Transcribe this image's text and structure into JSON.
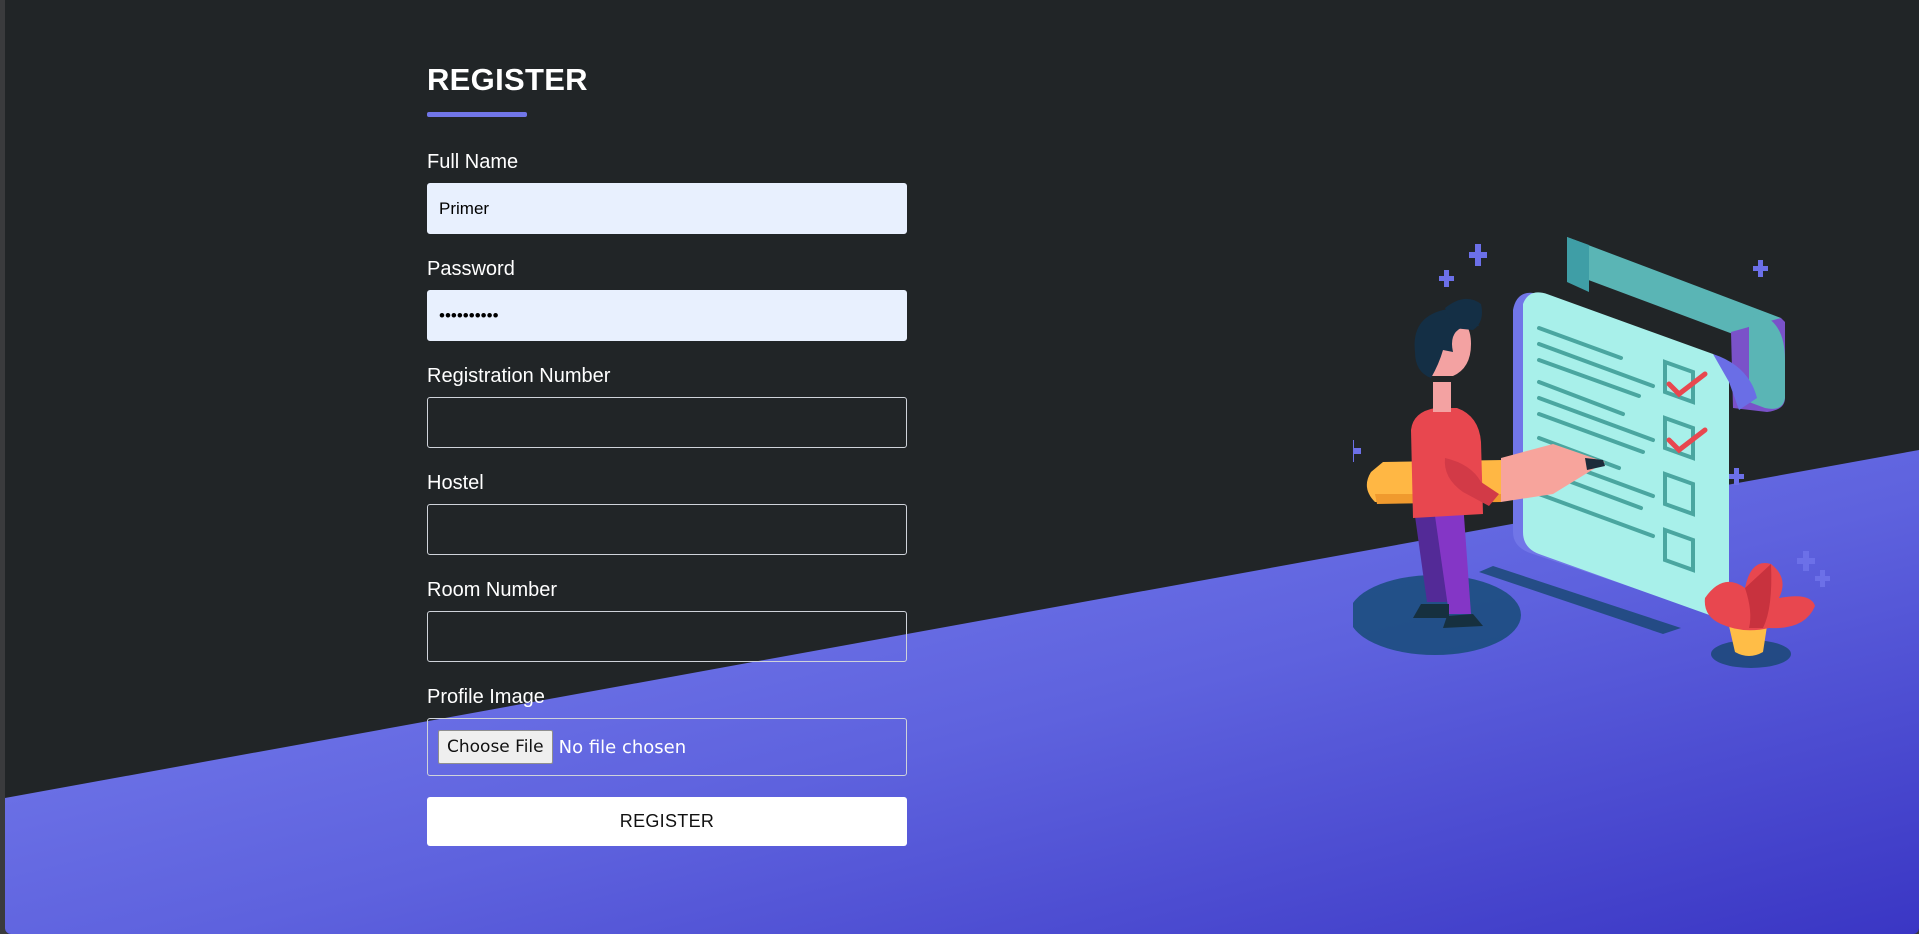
{
  "form": {
    "title": "REGISTER",
    "fields": [
      {
        "label": "Full Name",
        "value": "Primer",
        "placeholder": ""
      },
      {
        "label": "Password",
        "value": "••••••••••",
        "placeholder": ""
      },
      {
        "label": "Registration Number",
        "value": "",
        "placeholder": ""
      },
      {
        "label": "Hostel",
        "value": "",
        "placeholder": ""
      },
      {
        "label": "Room Number",
        "value": "",
        "placeholder": ""
      }
    ],
    "profile_image": {
      "label": "Profile Image",
      "button": "Choose File",
      "status": "No file chosen"
    },
    "submit_label": "REGISTER"
  },
  "colors": {
    "background": "#212527",
    "accent": "#7176e8",
    "slant_top": "#7b82f0",
    "slant_bottom": "#3b3cc6"
  },
  "illustration": {
    "icon": "checklist-illustration"
  }
}
